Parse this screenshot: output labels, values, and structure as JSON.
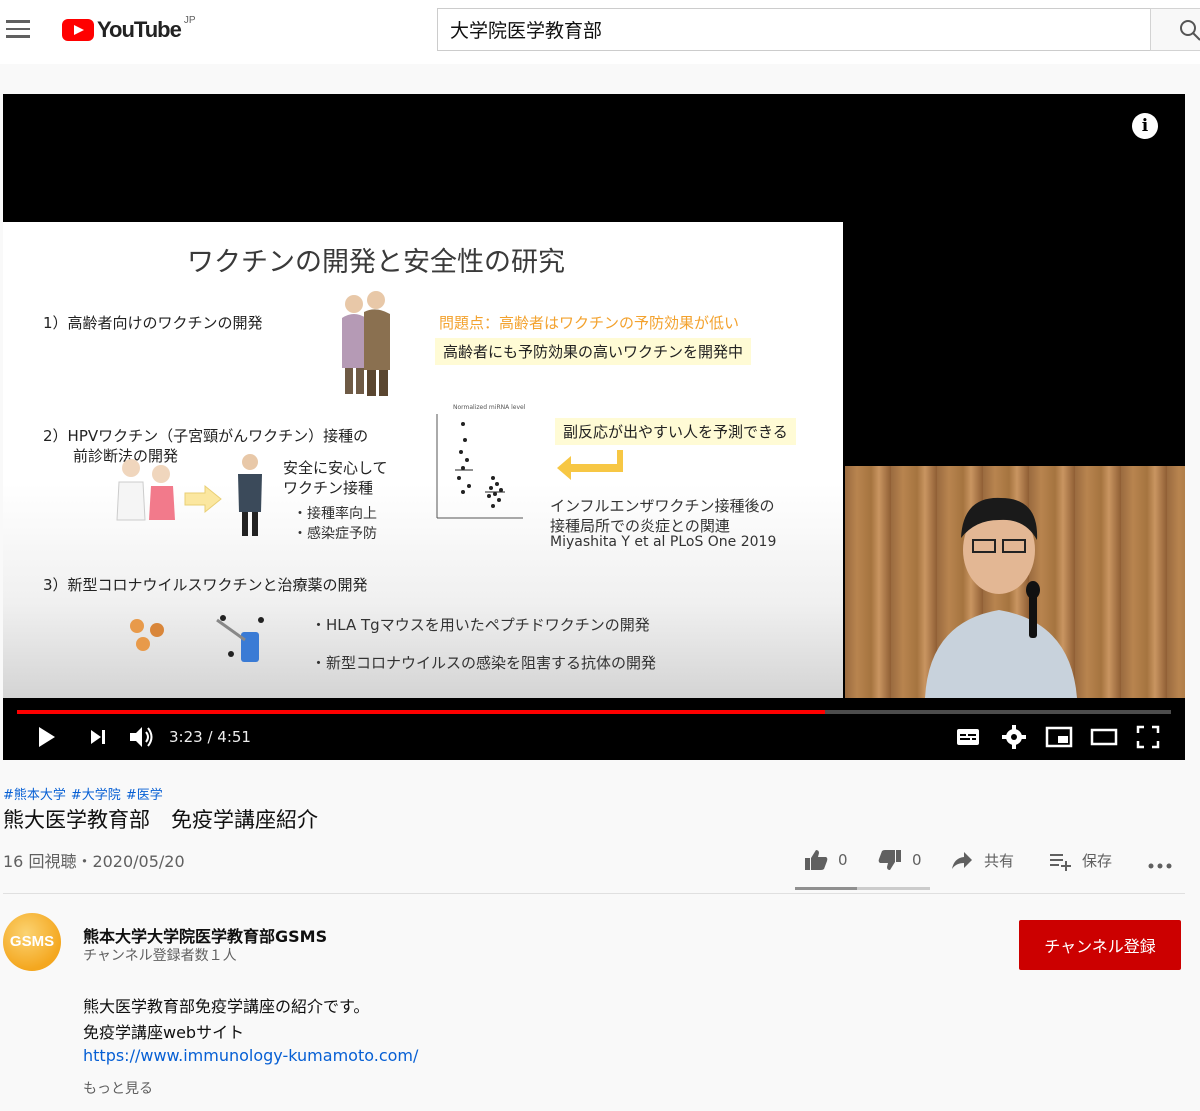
{
  "masthead": {
    "logo_text": "YouTube",
    "logo_region": "JP",
    "search_value": "大学院医学教育部"
  },
  "player": {
    "current_time": "3:23",
    "duration": "4:51",
    "time_display": "3:23 / 4:51",
    "progress_fraction": 0.7
  },
  "slide": {
    "title": "ワクチンの開発と安全性の研究",
    "section1": "1）高齢者向けのワクチンの開発",
    "problem": "問題点：高齢者はワクチンの予防効果が低い",
    "goal": "高齢者にも予防効果の高いワクチンを開発中",
    "section2_line1": "2）HPVワクチン（子宮頸がんワクチン）接種の",
    "section2_line2": "前診断法の開発",
    "safe_line1": "安全に安心して",
    "safe_line2": "ワクチン接種",
    "bullet1": "・接種率向上",
    "bullet2": "・感染症予防",
    "plot_label": "Normalized miRNA level",
    "side_effect": "副反応が出やすい人を予測できる",
    "flu_line1": "インフルエンザワクチン接種後の",
    "flu_line2": "接種局所での炎症との関連",
    "citation": "Miyashita Y et al PLoS One 2019",
    "section3": "3）新型コロナウイルスワクチンと治療薬の開発",
    "bullet3a": "・HLA Tgマウスを用いたペプチドワクチンの開発",
    "bullet3b": "・新型コロナウイルスの感染を阻害する抗体の開発"
  },
  "video": {
    "hashtags": [
      "#熊本大学",
      "#大学院",
      "#医学"
    ],
    "title": "熊大医学教育部　免疫学講座紹介",
    "views_date": "16 回視聴・2020/05/20",
    "like_count": "0",
    "dislike_count": "0",
    "share_label": "共有",
    "save_label": "保存"
  },
  "channel": {
    "avatar_text": "GSMS",
    "name": "熊本大学大学院医学教育部GSMS",
    "subscribers": "チャンネル登録者数１人",
    "subscribe_label": "チャンネル登録"
  },
  "description": {
    "line1": "熊大医学教育部免疫学講座の紹介です。",
    "line2": "免疫学講座webサイト",
    "link": "https://www.immunology-kumamoto.com/",
    "more": "もっと見る"
  },
  "colors": {
    "brand_red": "#ff0000",
    "subscribe_red": "#cc0000",
    "link_blue": "#065fd4",
    "slide_orange": "#f3a22e"
  }
}
